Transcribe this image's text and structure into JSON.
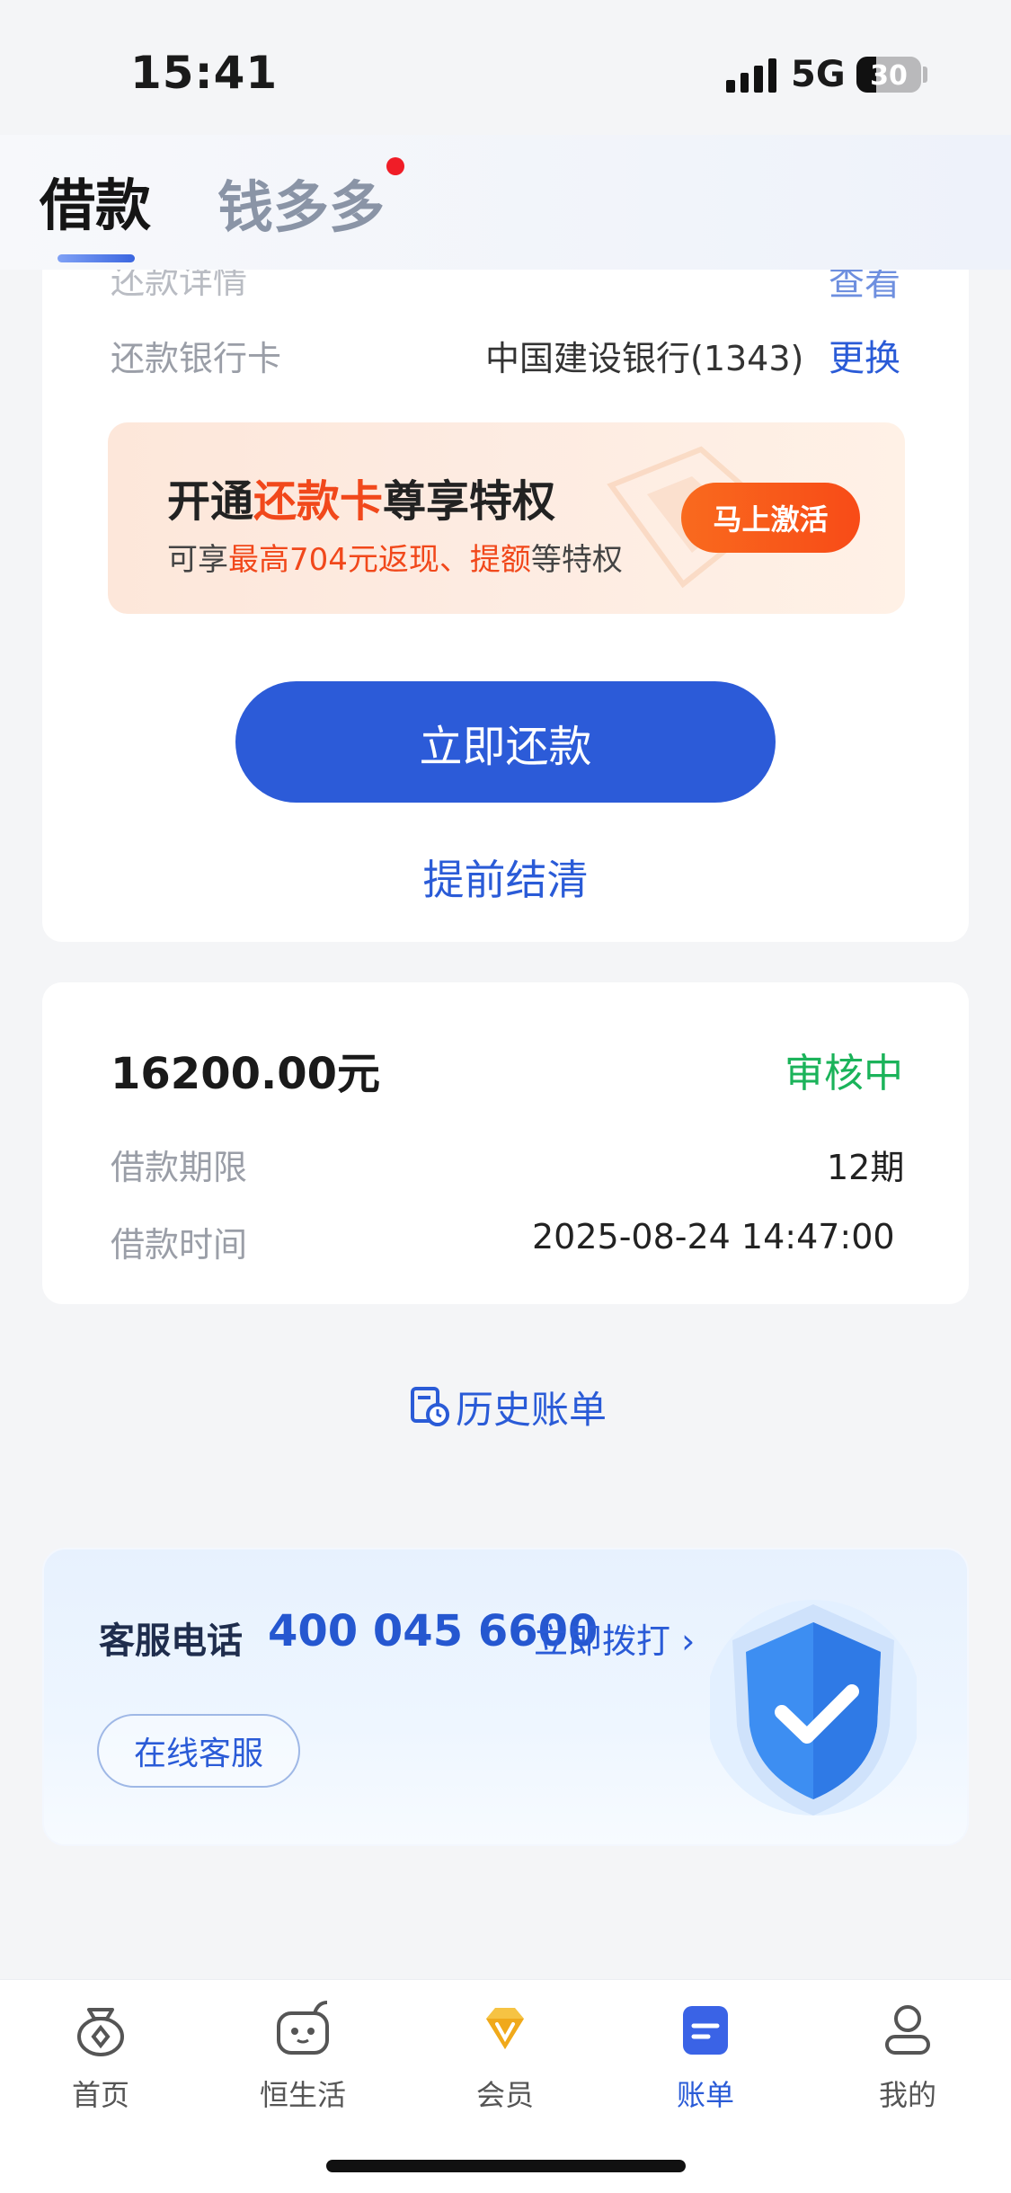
{
  "status_bar": {
    "time": "15:41",
    "network": "5G",
    "battery": "30"
  },
  "header": {
    "tabs": [
      {
        "label": "借款",
        "active": true
      },
      {
        "label": "钱多多",
        "active": false,
        "has_dot": true
      }
    ]
  },
  "repayment_card": {
    "partial_row": {
      "label": "还款详情",
      "link": "查看"
    },
    "bank_row": {
      "label": "还款银行卡",
      "value": "中国建设银行(1343)",
      "link": "更换"
    },
    "promo": {
      "title_pre": "开通",
      "title_highlight": "还款卡",
      "title_post": "尊享特权",
      "sub_pre": "可享",
      "sub_highlight1": "最高704元返现、",
      "sub_highlight2": "提额",
      "sub_post": "等特权",
      "button": "马上激活"
    },
    "repay_button": "立即还款",
    "early_settle": "提前结清"
  },
  "loan_record": {
    "amount": "16200.00元",
    "status": "审核中",
    "term_label": "借款期限",
    "term_value": "12期",
    "time_label": "借款时间",
    "time_value": "2025-08-24 14:47:00"
  },
  "history_link": "历史账单",
  "customer_service": {
    "label": "客服电话",
    "phone": "400 045 6600",
    "call": "立即拨打 ›",
    "online": "在线客服"
  },
  "bottom_nav": [
    {
      "label": "首页",
      "icon": "home-money-bag-icon"
    },
    {
      "label": "恒生活",
      "icon": "life-face-icon"
    },
    {
      "label": "会员",
      "icon": "member-diamond-icon"
    },
    {
      "label": "账单",
      "icon": "bill-icon",
      "active": true
    },
    {
      "label": "我的",
      "icon": "profile-icon"
    }
  ],
  "colors": {
    "primary": "#2c5bd8",
    "promo_accent": "#f1481b",
    "status_green": "#1bb35a",
    "notification_dot": "#f01d27"
  }
}
